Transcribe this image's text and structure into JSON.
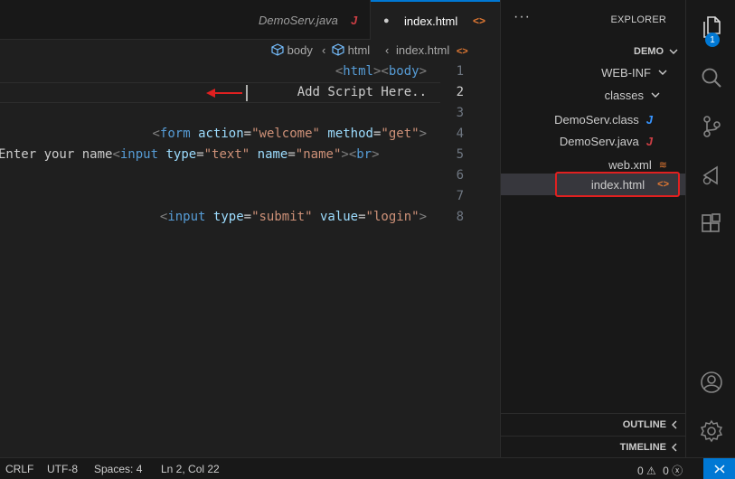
{
  "tabs": [
    {
      "label": "index.html",
      "icon": "html-icon",
      "modified_dot": "●",
      "active": true
    },
    {
      "label": "DemoServ.java",
      "icon": "java-icon",
      "active": false
    }
  ],
  "breadcrumb": [
    "index.html",
    "html",
    "body"
  ],
  "editor": {
    "lines": [
      {
        "num": "1",
        "text": "<html><body>"
      },
      {
        "num": "2",
        "text": "Add Script Here.."
      },
      {
        "num": "3",
        "text": ""
      },
      {
        "num": "4",
        "text": "<form action=\"welcome\" method=\"get\">"
      },
      {
        "num": "5",
        "text": "Enter your name<input type=\"text\" name=\"name\"><br>"
      },
      {
        "num": "6",
        "text": ""
      },
      {
        "num": "7",
        "text": ""
      },
      {
        "num": "8",
        "text": "<input type=\"submit\" value=\"login\">"
      }
    ],
    "current_line": "2"
  },
  "sidebar": {
    "title": "EXPLORER",
    "more": "···",
    "root": "DEMO",
    "items": [
      {
        "label": "WEB-INF",
        "kind": "folder"
      },
      {
        "label": "classes",
        "kind": "folder"
      },
      {
        "label": "DemoServ.class",
        "kind": "java-class"
      },
      {
        "label": "DemoServ.java",
        "kind": "java"
      },
      {
        "label": "web.xml",
        "kind": "xml"
      },
      {
        "label": "index.html",
        "kind": "html",
        "selected": true
      }
    ],
    "outline": "OUTLINE",
    "timeline": "TIMELINE"
  },
  "activity_badge": "1",
  "statusbar": {
    "errors": "0",
    "warnings": "0",
    "position": "Ln 2, Col 22",
    "spaces": "Spaces: 4",
    "encoding": "UTF-8",
    "eol": "CRLF"
  },
  "colors": {
    "accent": "#0078d4",
    "highlight_box": "#e02020",
    "html_icon": "#e37933",
    "java_icon": "#cc3e44"
  }
}
